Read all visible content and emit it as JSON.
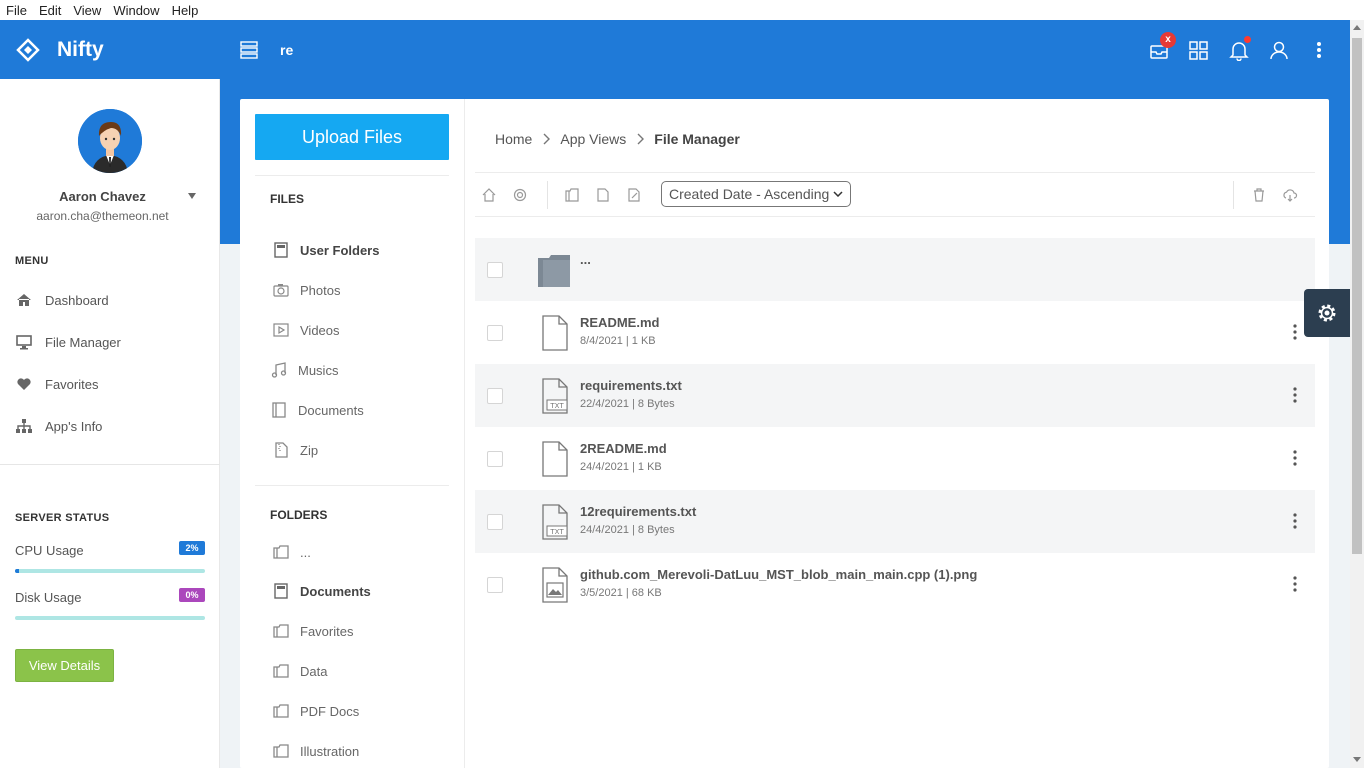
{
  "menubar": [
    "File",
    "Edit",
    "View",
    "Window",
    "Help"
  ],
  "brand": {
    "name": "Nifty",
    "accent": "#1f7ad8"
  },
  "header": {
    "search_text": "re",
    "notification_badge": "x"
  },
  "user": {
    "name": "Aaron Chavez",
    "email": "aaron.cha@themeon.net"
  },
  "sidebar": {
    "menu_title": "MENU",
    "items": [
      {
        "label": "Dashboard",
        "icon": "home-icon"
      },
      {
        "label": "File Manager",
        "icon": "monitor-icon"
      },
      {
        "label": "Favorites",
        "icon": "heart-icon"
      },
      {
        "label": "App's Info",
        "icon": "sitemap-icon"
      }
    ],
    "server_status_title": "SERVER STATUS",
    "cpu": {
      "label": "CPU Usage",
      "value": "2%",
      "fraction": 0.02,
      "color": "#1f7ad8"
    },
    "disk": {
      "label": "Disk Usage",
      "value": "0%",
      "fraction": 0.0,
      "color": "#ab47bc"
    },
    "view_details": "View Details"
  },
  "files_panel": {
    "upload_label": "Upload Files",
    "files_title": "FILES",
    "files": [
      {
        "label": "User Folders",
        "icon": "user-folder-icon"
      },
      {
        "label": "Photos",
        "icon": "camera-icon"
      },
      {
        "label": "Videos",
        "icon": "video-icon"
      },
      {
        "label": "Musics",
        "icon": "music-icon"
      },
      {
        "label": "Documents",
        "icon": "book-icon"
      },
      {
        "label": "Zip",
        "icon": "zip-icon"
      }
    ],
    "folders_title": "FOLDERS",
    "folders": [
      {
        "label": "..."
      },
      {
        "label": "Documents"
      },
      {
        "label": "Favorites"
      },
      {
        "label": "Data"
      },
      {
        "label": "PDF Docs"
      },
      {
        "label": "Illustration"
      }
    ]
  },
  "breadcrumb": {
    "home": "Home",
    "app_views": "App Views",
    "current": "File Manager"
  },
  "toolbar": {
    "sort_value": "Created Date - Ascending"
  },
  "file_list": [
    {
      "name": "...",
      "meta": "",
      "type": "folder"
    },
    {
      "name": "README.md",
      "meta": "8/4/2021 | 1 KB",
      "type": "file"
    },
    {
      "name": "requirements.txt",
      "meta": "22/4/2021 | 8 Bytes",
      "type": "txt"
    },
    {
      "name": "2README.md",
      "meta": "24/4/2021 | 1 KB",
      "type": "file"
    },
    {
      "name": "12requirements.txt",
      "meta": "24/4/2021 | 8 Bytes",
      "type": "txt"
    },
    {
      "name": "github.com_Merevoli-DatLuu_MST_blob_main_main.cpp (1).png",
      "meta": "3/5/2021 | 68 KB",
      "type": "image"
    }
  ]
}
